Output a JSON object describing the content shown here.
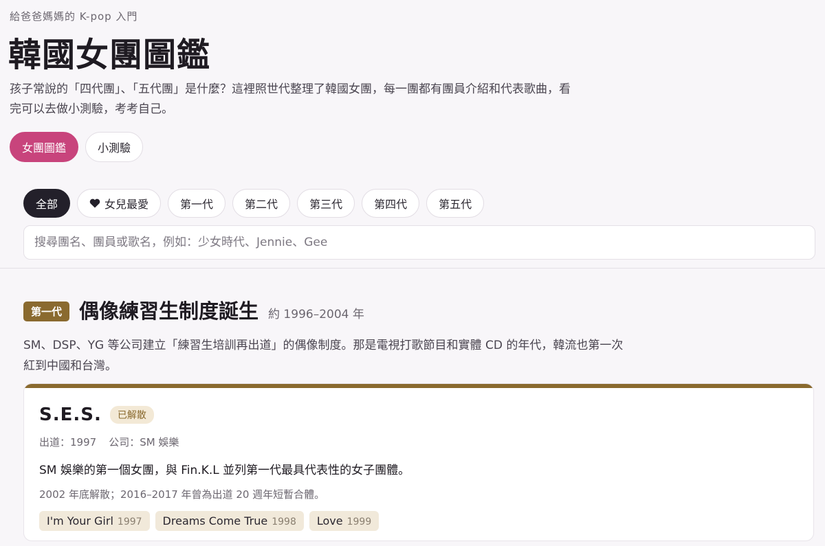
{
  "header": {
    "eyebrow": "給爸爸媽媽的 K-pop 入門",
    "title": "韓國女團圖鑑",
    "intro": "孩子常說的「四代團」、「五代團」是什麼？這裡照世代整理了韓國女團，每一團都有團員介紹和代表歌曲，看完可以去做小測驗，考考自己。"
  },
  "mode_tabs": [
    {
      "label": "女團圖鑑",
      "active": true
    },
    {
      "label": "小測驗",
      "active": false
    }
  ],
  "filters": [
    {
      "label": "全部",
      "active": true,
      "icon": ""
    },
    {
      "label": "女兒最愛",
      "active": false,
      "icon": "heart-icon"
    },
    {
      "label": "第一代",
      "active": false,
      "icon": ""
    },
    {
      "label": "第二代",
      "active": false,
      "icon": ""
    },
    {
      "label": "第三代",
      "active": false,
      "icon": ""
    },
    {
      "label": "第四代",
      "active": false,
      "icon": ""
    },
    {
      "label": "第五代",
      "active": false,
      "icon": ""
    }
  ],
  "search": {
    "placeholder": "搜尋團名、團員或歌名，例如：少女時代、Jennie、Gee",
    "value": ""
  },
  "section": {
    "badge": "第一代",
    "title": "偶像練習生制度誕生",
    "years": "約 1996–2004 年",
    "description": "SM、DSP、YG 等公司建立「練習生培訓再出道」的偶像制度。那是電視打歌節目和實體 CD 的年代，韓流也第一次紅到中國和台灣。",
    "accent_color": "#8a6a2f"
  },
  "card": {
    "name": "S.E.S.",
    "status": "已解散",
    "debut": "出道：1997",
    "company": "公司：SM 娛樂",
    "summary": "SM 娛樂的第一個女團，與 Fin.K.L 並列第一代最具代表性的女子團體。",
    "note": "2002 年底解散；2016–2017 年曾為出道 20 週年短暫合體。",
    "songs": [
      {
        "title": "I'm Your Girl",
        "year": "1997"
      },
      {
        "title": "Dreams Come True",
        "year": "1998"
      },
      {
        "title": "Love",
        "year": "1999"
      }
    ]
  },
  "colors": {
    "accent_pink": "#c8447c",
    "dark_chip": "#23202a",
    "gen1_gold": "#8a6a2f"
  }
}
